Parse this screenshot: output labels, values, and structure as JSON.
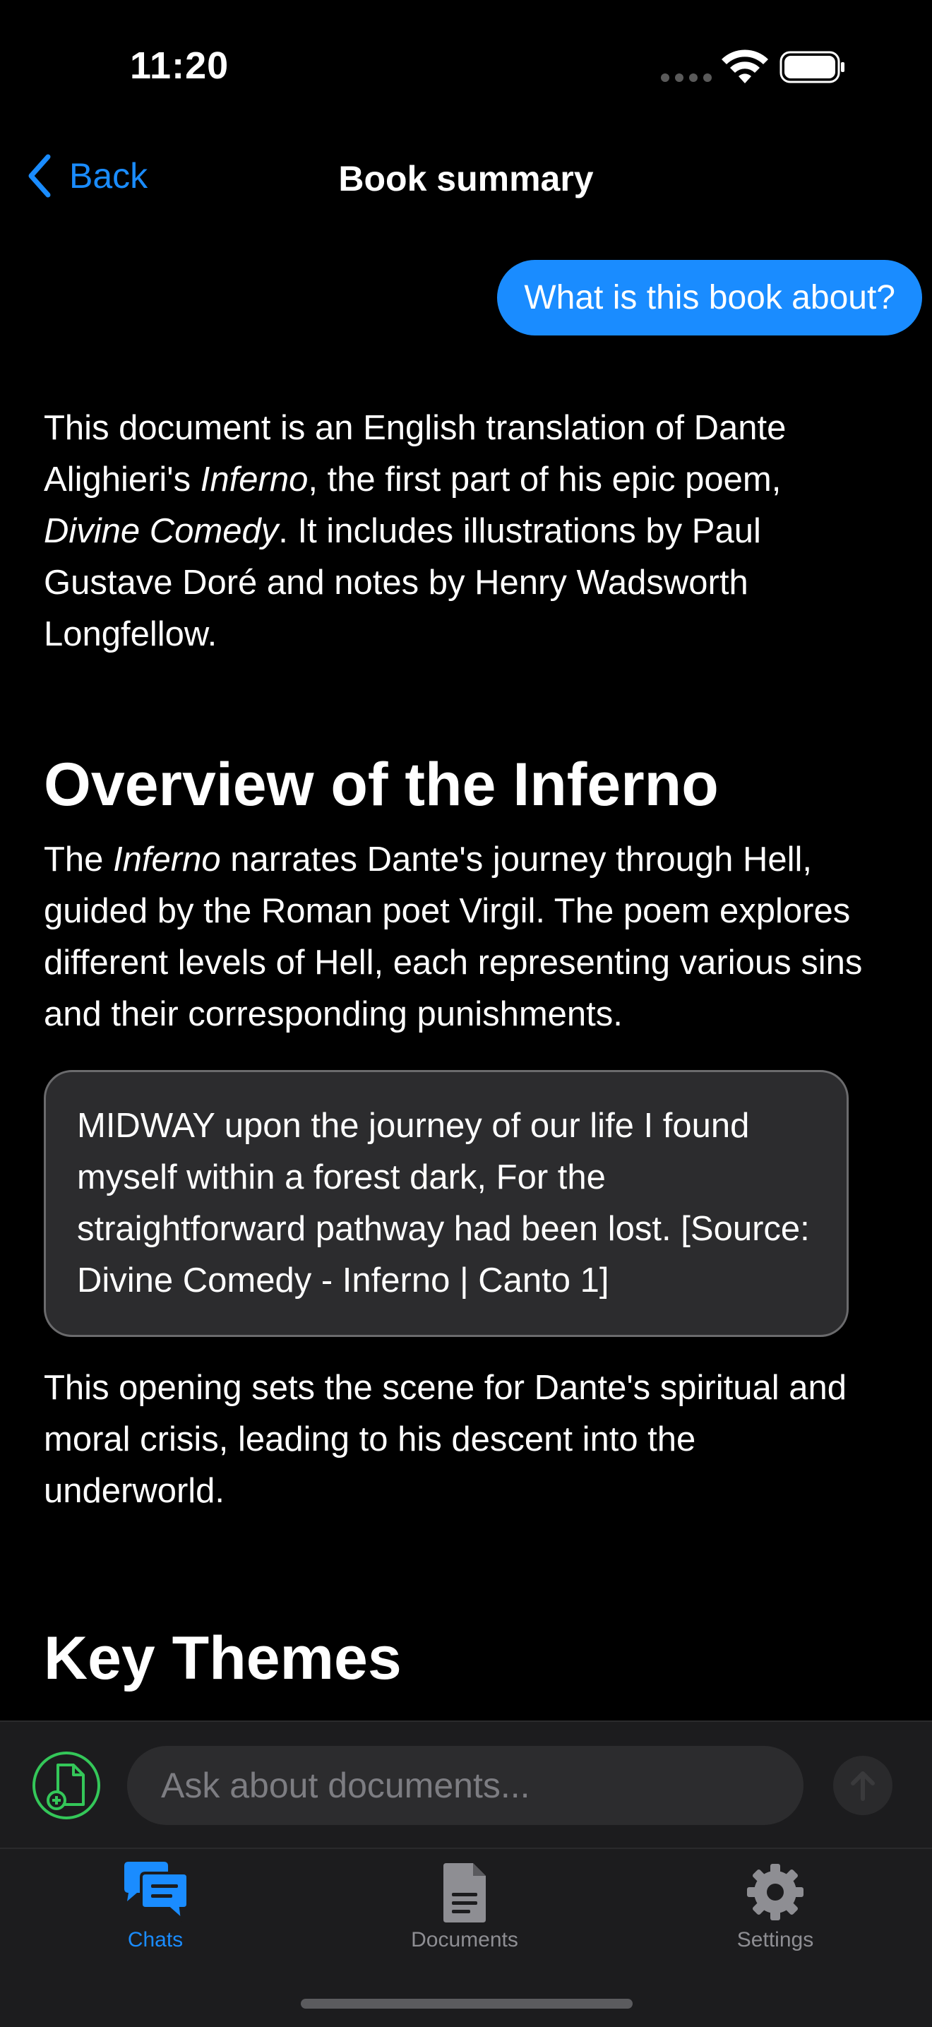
{
  "status_bar": {
    "time": "11:20"
  },
  "nav": {
    "back_label": "Back",
    "title": "Book summary"
  },
  "chat": {
    "user_message": "What is this book about?",
    "answer": {
      "intro": {
        "t1": "This document is an English translation of Dante Alighieri's ",
        "em1": "Inferno",
        "t2": ", the first part of his epic poem, ",
        "em2": "Divine Comedy",
        "t3": ". It includes illustrations by Paul Gustave Doré and notes by Henry Wadsworth Longfellow."
      },
      "heading1": "Overview of the Inferno",
      "overview": {
        "t1": "The ",
        "em1": "Inferno",
        "t2": " narrates Dante's journey through Hell, guided by the Roman poet Virgil. The poem explores different levels of Hell, each representing various sins and their corresponding punishments."
      },
      "quote": "MIDWAY upon the journey of our life I found myself within a forest dark, For the straightforward pathway had been lost. [Source: Divine Comedy - Inferno | Canto 1]",
      "closing": "This opening sets the scene for Dante's spiritual and moral crisis, leading to his descent into the underworld.",
      "heading2": "Key Themes"
    }
  },
  "input": {
    "placeholder": "Ask about documents..."
  },
  "tabs": [
    {
      "label": "Chats",
      "icon": "chat-bubbles-icon",
      "active": true
    },
    {
      "label": "Documents",
      "icon": "document-icon",
      "active": false
    },
    {
      "label": "Settings",
      "icon": "gear-icon",
      "active": false
    }
  ],
  "colors": {
    "accent": "#1a8cff",
    "attach": "#34c759",
    "background": "#000000",
    "quote_bg": "#2c2c2e"
  }
}
